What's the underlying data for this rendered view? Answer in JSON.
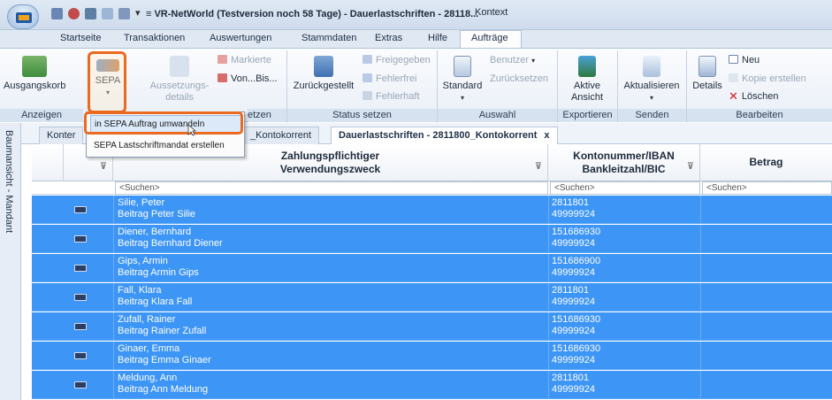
{
  "window": {
    "title": "≡ VR-NetWorld (Testversion noch 58 Tage) - Dauerlastschriften - 28118...",
    "context": "Kontext",
    "qa_dropdown": "▾"
  },
  "ribbon_tabs": [
    "Startseite",
    "Transaktionen",
    "Auswertungen",
    "Stammdaten",
    "Extras",
    "Hilfe",
    "Aufträge"
  ],
  "ribbon": {
    "ausgangskorb": "Ausgangskorb",
    "sepa": "SEPA",
    "aussetzungs": "Aussetzungs-",
    "details_label": "details",
    "markierte": "Markierte",
    "von_bis": "Von...Bis...",
    "zurueckgestellt": "Zurückgestellt",
    "freigegeben": "Freigegeben",
    "fehlerfrei": "Fehlerfrei",
    "fehlerhaft": "Fehlerhaft",
    "standard": "Standard",
    "benutzer": "Benutzer",
    "zuruecksetzen": "Zurücksetzen",
    "aktive": "Aktive",
    "ansicht": "Ansicht",
    "aktualisieren": "Aktualisieren",
    "details": "Details",
    "neu": "Neu",
    "kopie_erstellen": "Kopie erstellen",
    "loeschen": "Löschen",
    "groups": {
      "anzeigen": "Anzeigen",
      "setzen": "etzen",
      "status_setzen": "Status setzen",
      "auswahl": "Auswahl",
      "exportieren": "Exportieren",
      "senden": "Senden",
      "bearbeiten": "Bearbeiten"
    }
  },
  "sepa_menu": {
    "item1": "in SEPA Auftrag umwandeln",
    "item2": "SEPA Lastschriftmandat erstellen"
  },
  "side_panel": {
    "label": "Baumansicht - Mandant"
  },
  "doc_tabs": {
    "tab1": "Konter",
    "tab2": "_Kontokorrent",
    "tab3": "Dauerlastschriften - 2811800_Kontokorrent",
    "close": "x"
  },
  "grid": {
    "headers": {
      "payer_line1": "Zahlungspflichtiger",
      "payer_line2": "Verwendungszweck",
      "account_line1": "Kontonummer/IBAN",
      "account_line2": "Bankleitzahl/BIC",
      "amount": "Betrag"
    },
    "search_placeholder": "<Suchen>",
    "rows": [
      {
        "name": "Silie, Peter",
        "purpose": "Beitrag Peter Silie",
        "account": "2811801",
        "blz": "49999924"
      },
      {
        "name": "Diener, Bernhard",
        "purpose": "Beitrag Bernhard Diener",
        "account": "151686930",
        "blz": "49999924"
      },
      {
        "name": "Gips, Armin",
        "purpose": "Beitrag Armin Gips",
        "account": "151686900",
        "blz": "49999924"
      },
      {
        "name": "Fall, Klara",
        "purpose": "Beitrag Klara Fall",
        "account": "2811801",
        "blz": "49999924"
      },
      {
        "name": "Zufall, Rainer",
        "purpose": "Beitrag Rainer Zufall",
        "account": "151686930",
        "blz": "49999924"
      },
      {
        "name": "Ginaer, Emma",
        "purpose": "Beitrag Emma Ginaer",
        "account": "151686930",
        "blz": "49999924"
      },
      {
        "name": "Meldung, Ann",
        "purpose": "Beitrag Ann Meldung",
        "account": "2811801",
        "blz": "49999924"
      }
    ]
  },
  "colors": {
    "selection": "#3d95f5",
    "highlight": "#ea6a1f"
  }
}
